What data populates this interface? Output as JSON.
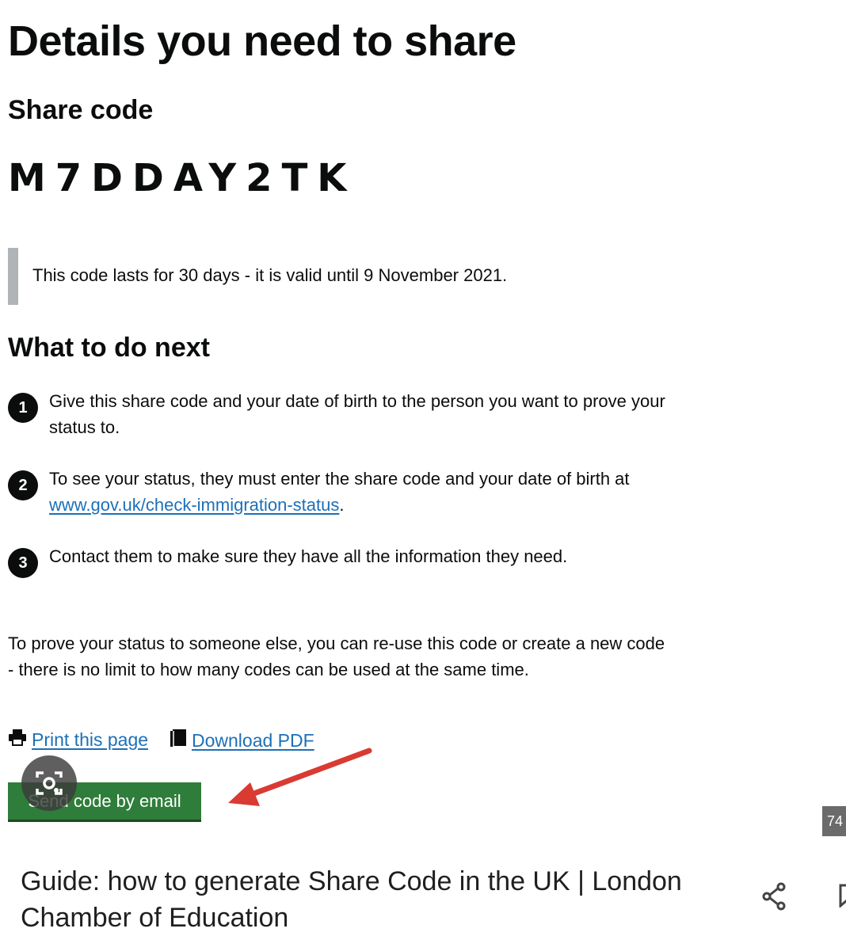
{
  "page": {
    "heading": "Details you need to share",
    "share_code_label": "Share code",
    "share_code": "M7DDAY2TK",
    "validity_notice": "This code lasts for 30 days - it is valid until 9 November 2021.",
    "next_heading": "What to do next",
    "steps": [
      {
        "number": "1",
        "text": "Give this share code and your date of birth to the person you want to prove your status to."
      },
      {
        "number": "2",
        "text_before": "To see your status, they must enter the share code and your date of birth at ",
        "link": "www.gov.uk/check-immigration-status",
        "text_after": "."
      },
      {
        "number": "3",
        "text": "Contact them to make sure they have all the information they need."
      }
    ],
    "reuse_text": "To prove your status to someone else, you can re-use this code or create a new code - there is no limit to how many codes can be used at the same time.",
    "print_label": "Print this page",
    "download_label": "Download PDF",
    "send_button_label": "Send code by email"
  },
  "overlay": {
    "badge_text": "74",
    "caption": "Guide: how to generate Share Code in the UK | London Chamber of Education",
    "icons": [
      "printer-icon",
      "document-icon",
      "lens-camera-icon",
      "share-icon",
      "bookmark-icon"
    ]
  },
  "colors": {
    "text": "#0b0c0c",
    "link": "#1d70b8",
    "button": "#2f7d3a",
    "inset_border": "#b1b4b6",
    "arrow": "#d93a32"
  }
}
